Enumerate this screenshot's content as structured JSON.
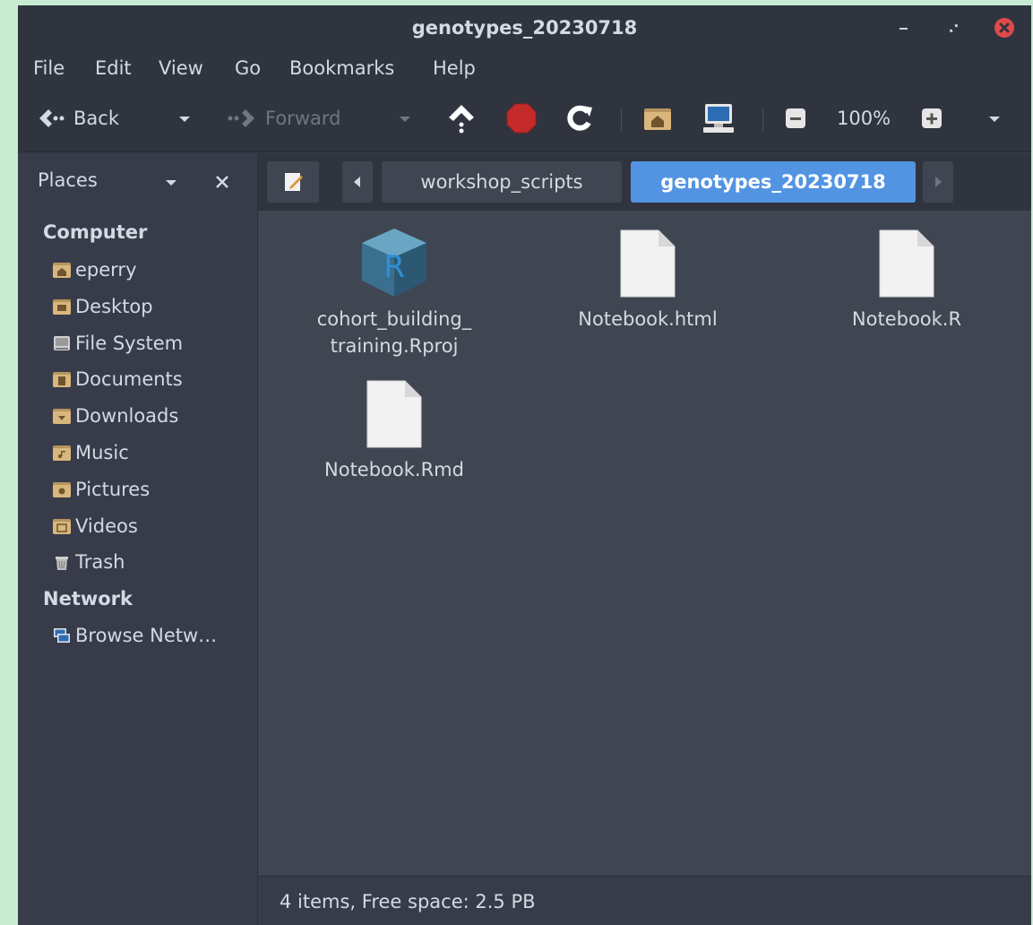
{
  "window": {
    "title": "genotypes_20230718"
  },
  "menu": [
    "File",
    "Edit",
    "View",
    "Go",
    "Bookmarks",
    "Help"
  ],
  "toolbar": {
    "back_label": "Back",
    "forward_label": "Forward",
    "zoom_level": "100%"
  },
  "sidebar": {
    "header_label": "Places",
    "sections": [
      {
        "title": "Computer",
        "items": [
          {
            "label": "eperry",
            "icon": "home-folder-icon"
          },
          {
            "label": "Desktop",
            "icon": "desktop-folder-icon"
          },
          {
            "label": "File System",
            "icon": "drive-icon"
          },
          {
            "label": "Documents",
            "icon": "documents-folder-icon"
          },
          {
            "label": "Downloads",
            "icon": "downloads-folder-icon"
          },
          {
            "label": "Music",
            "icon": "music-folder-icon"
          },
          {
            "label": "Pictures",
            "icon": "pictures-folder-icon"
          },
          {
            "label": "Videos",
            "icon": "videos-folder-icon"
          },
          {
            "label": "Trash",
            "icon": "trash-icon"
          }
        ]
      },
      {
        "title": "Network",
        "items": [
          {
            "label": "Browse Netw…",
            "icon": "network-icon"
          }
        ]
      }
    ]
  },
  "location": {
    "crumbs": [
      "workshop_scripts",
      "genotypes_20230718"
    ],
    "active_index": 1
  },
  "files": [
    {
      "name_line1": "cohort_building_",
      "name_line2": "training.Rproj",
      "icon": "rproj-file-icon"
    },
    {
      "name_line1": "Notebook.html",
      "name_line2": "",
      "icon": "generic-file-icon"
    },
    {
      "name_line1": "Notebook.R",
      "name_line2": "",
      "icon": "generic-file-icon"
    },
    {
      "name_line1": "Notebook.Rmd",
      "name_line2": "",
      "icon": "generic-file-icon"
    }
  ],
  "status": {
    "text": "4 items, Free space: 2.5 PB"
  },
  "colors": {
    "accent": "#5294e2",
    "window_bg": "#383c4a",
    "content_bg": "#404552",
    "close_button": "#e14a4a"
  }
}
